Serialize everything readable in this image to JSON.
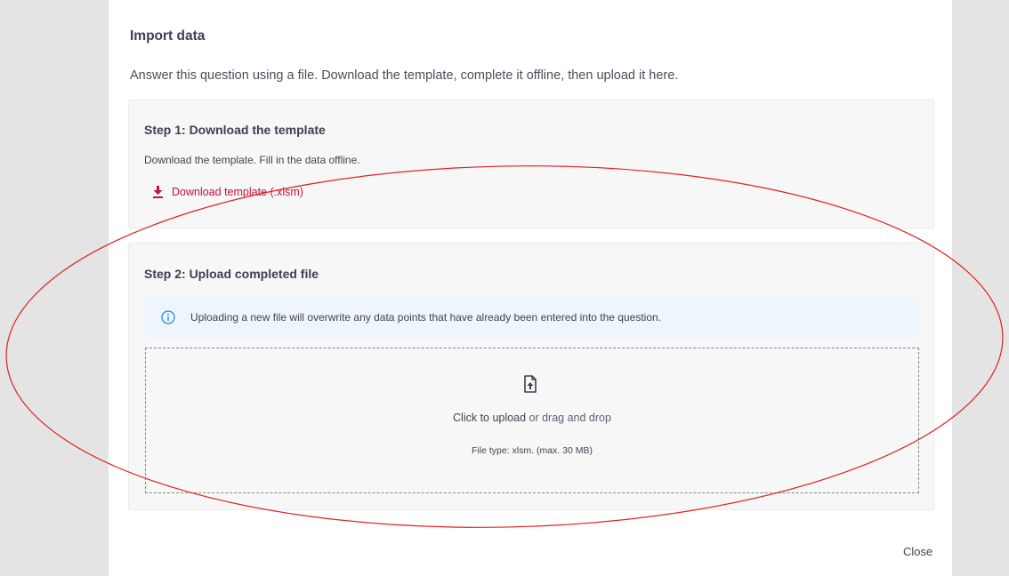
{
  "dialog": {
    "title": "Import data",
    "intro": "Answer this question using a file. Download the template, complete it offline, then upload it here.",
    "close_label": "Close"
  },
  "step1": {
    "title": "Step 1: Download the template",
    "description": "Download the template. Fill in the data offline.",
    "link_label": "Download template (.xlsm)",
    "link_icon": "download-icon"
  },
  "step2": {
    "title": "Step 2: Upload completed file",
    "info_icon": "info-icon",
    "info_text": "Uploading a new file will overwrite any data points that have already been entered into the question.",
    "upload_icon": "file-upload-icon",
    "upload_prefix": "Click to upload",
    "upload_suffix": "or drag and drop",
    "file_type": "File type: xlsm. (max. 30 MB)"
  },
  "colors": {
    "accent_red": "#c8103e",
    "info_blue": "#1e88e5",
    "annotation_red": "#e02020"
  }
}
